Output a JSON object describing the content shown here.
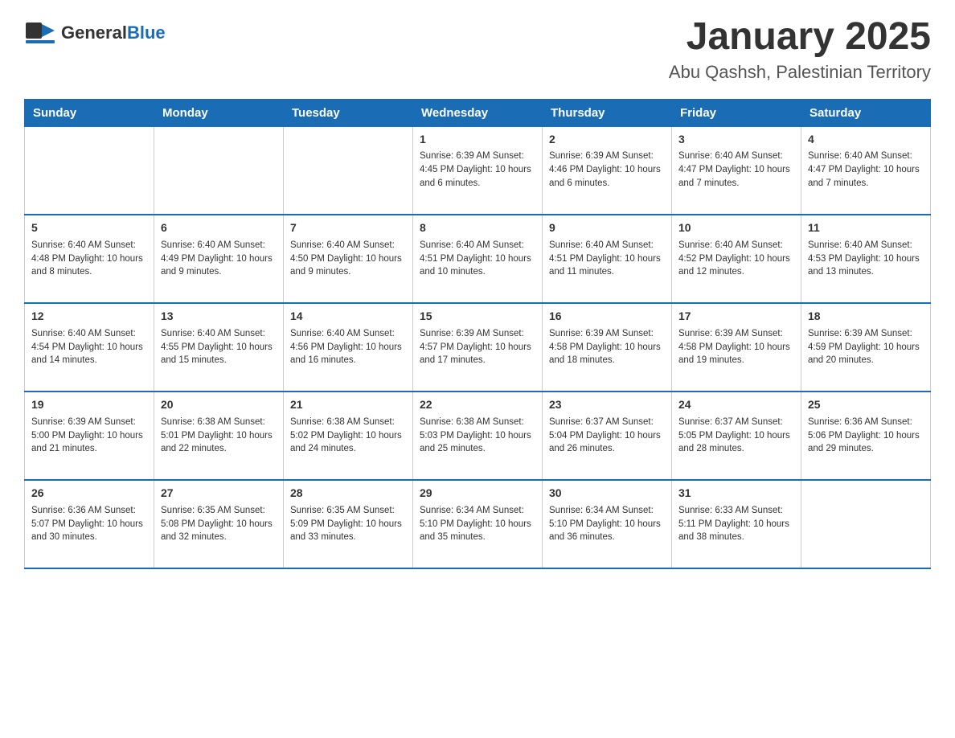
{
  "header": {
    "logo_general": "General",
    "logo_blue": "Blue",
    "title": "January 2025",
    "subtitle": "Abu Qashsh, Palestinian Territory"
  },
  "days_of_week": [
    "Sunday",
    "Monday",
    "Tuesday",
    "Wednesday",
    "Thursday",
    "Friday",
    "Saturday"
  ],
  "weeks": [
    [
      {
        "day": "",
        "info": ""
      },
      {
        "day": "",
        "info": ""
      },
      {
        "day": "",
        "info": ""
      },
      {
        "day": "1",
        "info": "Sunrise: 6:39 AM\nSunset: 4:45 PM\nDaylight: 10 hours and 6 minutes."
      },
      {
        "day": "2",
        "info": "Sunrise: 6:39 AM\nSunset: 4:46 PM\nDaylight: 10 hours and 6 minutes."
      },
      {
        "day": "3",
        "info": "Sunrise: 6:40 AM\nSunset: 4:47 PM\nDaylight: 10 hours and 7 minutes."
      },
      {
        "day": "4",
        "info": "Sunrise: 6:40 AM\nSunset: 4:47 PM\nDaylight: 10 hours and 7 minutes."
      }
    ],
    [
      {
        "day": "5",
        "info": "Sunrise: 6:40 AM\nSunset: 4:48 PM\nDaylight: 10 hours and 8 minutes."
      },
      {
        "day": "6",
        "info": "Sunrise: 6:40 AM\nSunset: 4:49 PM\nDaylight: 10 hours and 9 minutes."
      },
      {
        "day": "7",
        "info": "Sunrise: 6:40 AM\nSunset: 4:50 PM\nDaylight: 10 hours and 9 minutes."
      },
      {
        "day": "8",
        "info": "Sunrise: 6:40 AM\nSunset: 4:51 PM\nDaylight: 10 hours and 10 minutes."
      },
      {
        "day": "9",
        "info": "Sunrise: 6:40 AM\nSunset: 4:51 PM\nDaylight: 10 hours and 11 minutes."
      },
      {
        "day": "10",
        "info": "Sunrise: 6:40 AM\nSunset: 4:52 PM\nDaylight: 10 hours and 12 minutes."
      },
      {
        "day": "11",
        "info": "Sunrise: 6:40 AM\nSunset: 4:53 PM\nDaylight: 10 hours and 13 minutes."
      }
    ],
    [
      {
        "day": "12",
        "info": "Sunrise: 6:40 AM\nSunset: 4:54 PM\nDaylight: 10 hours and 14 minutes."
      },
      {
        "day": "13",
        "info": "Sunrise: 6:40 AM\nSunset: 4:55 PM\nDaylight: 10 hours and 15 minutes."
      },
      {
        "day": "14",
        "info": "Sunrise: 6:40 AM\nSunset: 4:56 PM\nDaylight: 10 hours and 16 minutes."
      },
      {
        "day": "15",
        "info": "Sunrise: 6:39 AM\nSunset: 4:57 PM\nDaylight: 10 hours and 17 minutes."
      },
      {
        "day": "16",
        "info": "Sunrise: 6:39 AM\nSunset: 4:58 PM\nDaylight: 10 hours and 18 minutes."
      },
      {
        "day": "17",
        "info": "Sunrise: 6:39 AM\nSunset: 4:58 PM\nDaylight: 10 hours and 19 minutes."
      },
      {
        "day": "18",
        "info": "Sunrise: 6:39 AM\nSunset: 4:59 PM\nDaylight: 10 hours and 20 minutes."
      }
    ],
    [
      {
        "day": "19",
        "info": "Sunrise: 6:39 AM\nSunset: 5:00 PM\nDaylight: 10 hours and 21 minutes."
      },
      {
        "day": "20",
        "info": "Sunrise: 6:38 AM\nSunset: 5:01 PM\nDaylight: 10 hours and 22 minutes."
      },
      {
        "day": "21",
        "info": "Sunrise: 6:38 AM\nSunset: 5:02 PM\nDaylight: 10 hours and 24 minutes."
      },
      {
        "day": "22",
        "info": "Sunrise: 6:38 AM\nSunset: 5:03 PM\nDaylight: 10 hours and 25 minutes."
      },
      {
        "day": "23",
        "info": "Sunrise: 6:37 AM\nSunset: 5:04 PM\nDaylight: 10 hours and 26 minutes."
      },
      {
        "day": "24",
        "info": "Sunrise: 6:37 AM\nSunset: 5:05 PM\nDaylight: 10 hours and 28 minutes."
      },
      {
        "day": "25",
        "info": "Sunrise: 6:36 AM\nSunset: 5:06 PM\nDaylight: 10 hours and 29 minutes."
      }
    ],
    [
      {
        "day": "26",
        "info": "Sunrise: 6:36 AM\nSunset: 5:07 PM\nDaylight: 10 hours and 30 minutes."
      },
      {
        "day": "27",
        "info": "Sunrise: 6:35 AM\nSunset: 5:08 PM\nDaylight: 10 hours and 32 minutes."
      },
      {
        "day": "28",
        "info": "Sunrise: 6:35 AM\nSunset: 5:09 PM\nDaylight: 10 hours and 33 minutes."
      },
      {
        "day": "29",
        "info": "Sunrise: 6:34 AM\nSunset: 5:10 PM\nDaylight: 10 hours and 35 minutes."
      },
      {
        "day": "30",
        "info": "Sunrise: 6:34 AM\nSunset: 5:10 PM\nDaylight: 10 hours and 36 minutes."
      },
      {
        "day": "31",
        "info": "Sunrise: 6:33 AM\nSunset: 5:11 PM\nDaylight: 10 hours and 38 minutes."
      },
      {
        "day": "",
        "info": ""
      }
    ]
  ]
}
